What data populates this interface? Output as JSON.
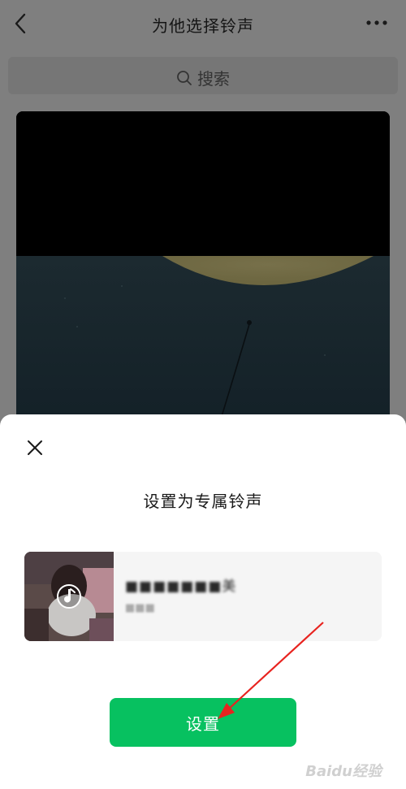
{
  "header": {
    "title": "为他选择铃声"
  },
  "search": {
    "placeholder": "搜索"
  },
  "sheet": {
    "title": "设置为专属铃声",
    "song_title": "■■■■■■■美",
    "song_artist": "■■■",
    "set_button_label": "设置"
  },
  "watermark": {
    "text": "Baidu经验"
  },
  "colors": {
    "accent": "#07c160",
    "overlay": "#7f7f7f",
    "annotation_arrow": "#e8231f"
  },
  "icons": [
    "back-arrow-icon",
    "more-dots-icon",
    "search-icon",
    "close-icon",
    "music-note-icon"
  ]
}
